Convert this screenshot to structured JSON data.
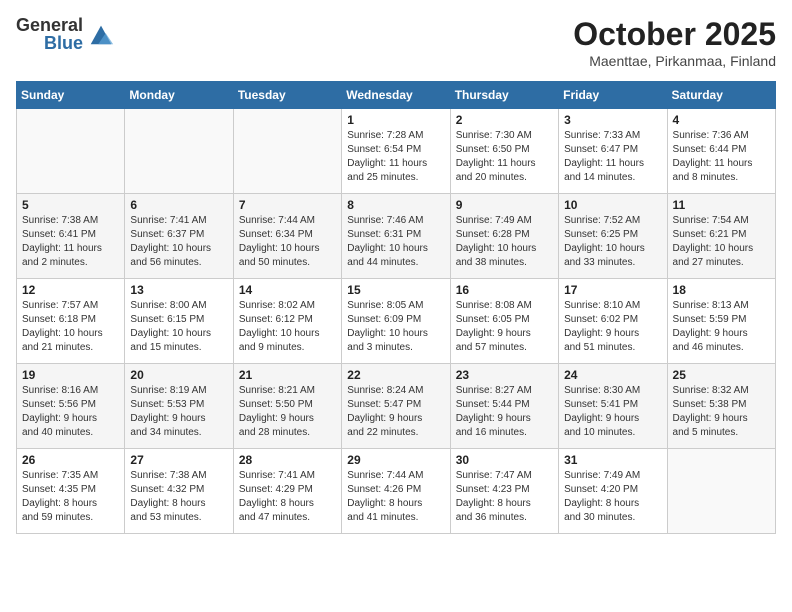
{
  "header": {
    "logo_general": "General",
    "logo_blue": "Blue",
    "month": "October 2025",
    "location": "Maenttae, Pirkanmaa, Finland"
  },
  "weekdays": [
    "Sunday",
    "Monday",
    "Tuesday",
    "Wednesday",
    "Thursday",
    "Friday",
    "Saturday"
  ],
  "weeks": [
    [
      {
        "day": "",
        "info": ""
      },
      {
        "day": "",
        "info": ""
      },
      {
        "day": "",
        "info": ""
      },
      {
        "day": "1",
        "info": "Sunrise: 7:28 AM\nSunset: 6:54 PM\nDaylight: 11 hours\nand 25 minutes."
      },
      {
        "day": "2",
        "info": "Sunrise: 7:30 AM\nSunset: 6:50 PM\nDaylight: 11 hours\nand 20 minutes."
      },
      {
        "day": "3",
        "info": "Sunrise: 7:33 AM\nSunset: 6:47 PM\nDaylight: 11 hours\nand 14 minutes."
      },
      {
        "day": "4",
        "info": "Sunrise: 7:36 AM\nSunset: 6:44 PM\nDaylight: 11 hours\nand 8 minutes."
      }
    ],
    [
      {
        "day": "5",
        "info": "Sunrise: 7:38 AM\nSunset: 6:41 PM\nDaylight: 11 hours\nand 2 minutes."
      },
      {
        "day": "6",
        "info": "Sunrise: 7:41 AM\nSunset: 6:37 PM\nDaylight: 10 hours\nand 56 minutes."
      },
      {
        "day": "7",
        "info": "Sunrise: 7:44 AM\nSunset: 6:34 PM\nDaylight: 10 hours\nand 50 minutes."
      },
      {
        "day": "8",
        "info": "Sunrise: 7:46 AM\nSunset: 6:31 PM\nDaylight: 10 hours\nand 44 minutes."
      },
      {
        "day": "9",
        "info": "Sunrise: 7:49 AM\nSunset: 6:28 PM\nDaylight: 10 hours\nand 38 minutes."
      },
      {
        "day": "10",
        "info": "Sunrise: 7:52 AM\nSunset: 6:25 PM\nDaylight: 10 hours\nand 33 minutes."
      },
      {
        "day": "11",
        "info": "Sunrise: 7:54 AM\nSunset: 6:21 PM\nDaylight: 10 hours\nand 27 minutes."
      }
    ],
    [
      {
        "day": "12",
        "info": "Sunrise: 7:57 AM\nSunset: 6:18 PM\nDaylight: 10 hours\nand 21 minutes."
      },
      {
        "day": "13",
        "info": "Sunrise: 8:00 AM\nSunset: 6:15 PM\nDaylight: 10 hours\nand 15 minutes."
      },
      {
        "day": "14",
        "info": "Sunrise: 8:02 AM\nSunset: 6:12 PM\nDaylight: 10 hours\nand 9 minutes."
      },
      {
        "day": "15",
        "info": "Sunrise: 8:05 AM\nSunset: 6:09 PM\nDaylight: 10 hours\nand 3 minutes."
      },
      {
        "day": "16",
        "info": "Sunrise: 8:08 AM\nSunset: 6:05 PM\nDaylight: 9 hours\nand 57 minutes."
      },
      {
        "day": "17",
        "info": "Sunrise: 8:10 AM\nSunset: 6:02 PM\nDaylight: 9 hours\nand 51 minutes."
      },
      {
        "day": "18",
        "info": "Sunrise: 8:13 AM\nSunset: 5:59 PM\nDaylight: 9 hours\nand 46 minutes."
      }
    ],
    [
      {
        "day": "19",
        "info": "Sunrise: 8:16 AM\nSunset: 5:56 PM\nDaylight: 9 hours\nand 40 minutes."
      },
      {
        "day": "20",
        "info": "Sunrise: 8:19 AM\nSunset: 5:53 PM\nDaylight: 9 hours\nand 34 minutes."
      },
      {
        "day": "21",
        "info": "Sunrise: 8:21 AM\nSunset: 5:50 PM\nDaylight: 9 hours\nand 28 minutes."
      },
      {
        "day": "22",
        "info": "Sunrise: 8:24 AM\nSunset: 5:47 PM\nDaylight: 9 hours\nand 22 minutes."
      },
      {
        "day": "23",
        "info": "Sunrise: 8:27 AM\nSunset: 5:44 PM\nDaylight: 9 hours\nand 16 minutes."
      },
      {
        "day": "24",
        "info": "Sunrise: 8:30 AM\nSunset: 5:41 PM\nDaylight: 9 hours\nand 10 minutes."
      },
      {
        "day": "25",
        "info": "Sunrise: 8:32 AM\nSunset: 5:38 PM\nDaylight: 9 hours\nand 5 minutes."
      }
    ],
    [
      {
        "day": "26",
        "info": "Sunrise: 7:35 AM\nSunset: 4:35 PM\nDaylight: 8 hours\nand 59 minutes."
      },
      {
        "day": "27",
        "info": "Sunrise: 7:38 AM\nSunset: 4:32 PM\nDaylight: 8 hours\nand 53 minutes."
      },
      {
        "day": "28",
        "info": "Sunrise: 7:41 AM\nSunset: 4:29 PM\nDaylight: 8 hours\nand 47 minutes."
      },
      {
        "day": "29",
        "info": "Sunrise: 7:44 AM\nSunset: 4:26 PM\nDaylight: 8 hours\nand 41 minutes."
      },
      {
        "day": "30",
        "info": "Sunrise: 7:47 AM\nSunset: 4:23 PM\nDaylight: 8 hours\nand 36 minutes."
      },
      {
        "day": "31",
        "info": "Sunrise: 7:49 AM\nSunset: 4:20 PM\nDaylight: 8 hours\nand 30 minutes."
      },
      {
        "day": "",
        "info": ""
      }
    ]
  ]
}
